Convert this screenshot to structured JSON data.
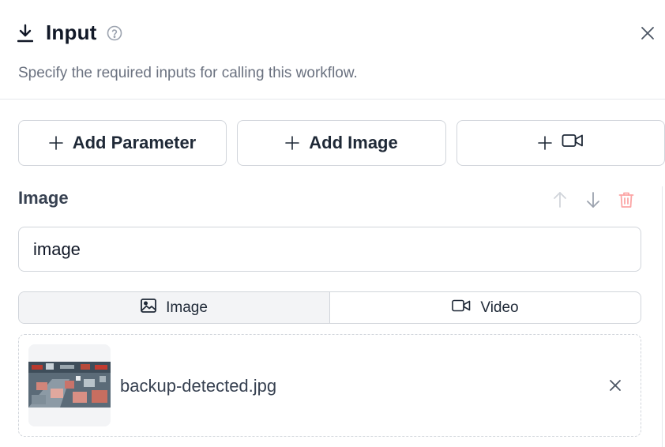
{
  "header": {
    "title": "Input",
    "subtitle": "Specify the required inputs for calling this workflow.",
    "icon": "download-icon",
    "help_icon": "help-circle-icon",
    "close_icon": "close-icon"
  },
  "add_buttons": [
    {
      "label": "Add Parameter",
      "icon": "plus-icon"
    },
    {
      "label": "Add Image",
      "icon": "plus-icon"
    },
    {
      "label": "",
      "icon": "video-camera-icon"
    }
  ],
  "input_item": {
    "section_title": "Image",
    "actions": [
      "arrow-up-icon",
      "arrow-down-icon",
      "trash-icon"
    ],
    "name_value": "image",
    "type_toggle": {
      "options": [
        {
          "label": "Image",
          "icon": "image-icon",
          "selected": true
        },
        {
          "label": "Video",
          "icon": "video-camera-icon",
          "selected": false
        }
      ]
    },
    "file": {
      "name": "backup-detected.jpg",
      "remove_icon": "close-icon"
    }
  },
  "colors": {
    "text_primary": "#111827",
    "text_muted": "#6b7280",
    "border": "#d1d5db",
    "danger_faded": "#fca5a5",
    "toggle_active_bg": "#f3f4f6"
  }
}
